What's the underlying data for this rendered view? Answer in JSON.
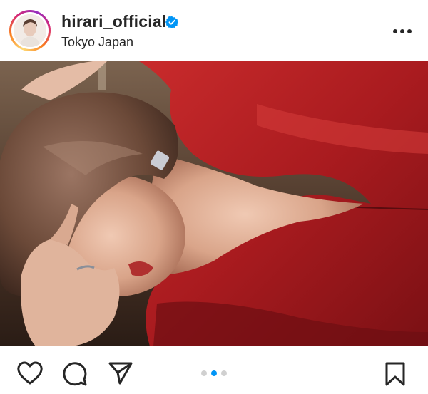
{
  "post": {
    "username": "hirari_official",
    "location": "Tokyo Japan",
    "verified": true
  },
  "icons": {
    "verified": "verified-badge-icon",
    "more": "more-options-icon",
    "like": "heart-icon",
    "comment": "comment-icon",
    "share": "send-icon",
    "save": "bookmark-icon"
  },
  "carousel": {
    "total": 3,
    "active_index": 1
  },
  "colors": {
    "accent": "#0095f6",
    "inactive_dot": "#a8a8a8",
    "dress": "#b31e22"
  }
}
